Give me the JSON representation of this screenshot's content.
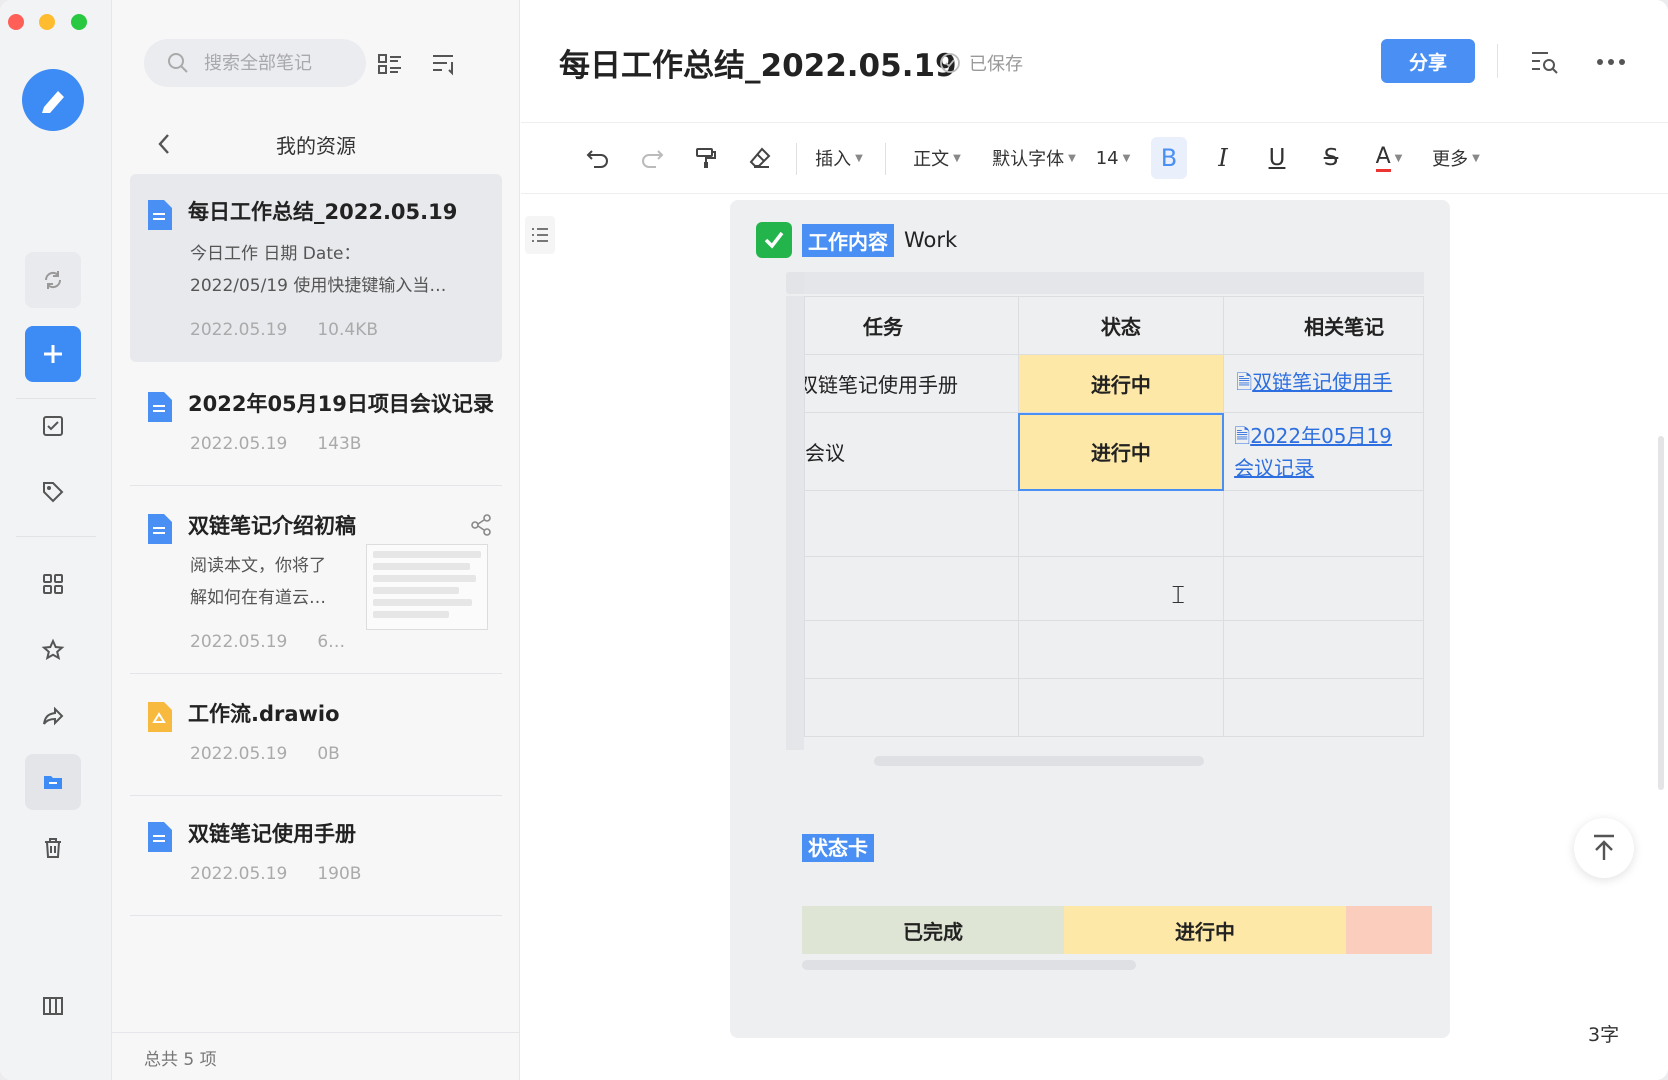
{
  "rail": {
    "items": [
      "sync",
      "add",
      "todo",
      "tags",
      "apps",
      "favorites",
      "shared",
      "my-resources",
      "trash",
      "layout"
    ]
  },
  "list": {
    "search_placeholder": "搜索全部笔记",
    "header": "我的资源",
    "footer": "总共 5 项",
    "items": [
      {
        "title": "每日工作总结_2022.05.19",
        "snippet1": "今日工作 日期 Date：",
        "snippet2": "2022/05/19 使用快捷键输入当…",
        "date": "2022.05.19",
        "size": "10.4KB"
      },
      {
        "title": "2022年05月19日项目会议记录",
        "date": "2022.05.19",
        "size": "143B"
      },
      {
        "title": "双链笔记介绍初稿",
        "snippet1": "阅读本文，你将了",
        "snippet2": "解如何在有道云…",
        "date": "2022.05.19",
        "size": "6…"
      },
      {
        "title": "工作流.drawio",
        "date": "2022.05.19",
        "size": "0B"
      },
      {
        "title": "双链笔记使用手册",
        "date": "2022.05.19",
        "size": "190B"
      }
    ]
  },
  "editor": {
    "title": "每日工作总结_2022.05.19",
    "saved": "已保存",
    "share": "分享",
    "toolbar": {
      "insert": "插入",
      "style": "正文",
      "font": "默认字体",
      "size": "14",
      "bold": "B",
      "italic": "I",
      "underline": "U",
      "strike": "S",
      "color": "A",
      "more": "更多"
    },
    "block": {
      "label": "工作内容",
      "label_en": "Work",
      "table": {
        "headers": [
          "任务",
          "状态",
          "相关笔记"
        ],
        "rows": [
          {
            "task": "双链笔记使用手册",
            "status": "进行中",
            "link": "双链笔记使用手"
          },
          {
            "task": "会议",
            "status": "进行中",
            "link1": "2022年05月19",
            "link2": "会议记录"
          }
        ]
      },
      "status_label": "状态卡",
      "status_bar": {
        "done": "已完成",
        "progress": "进行中"
      }
    },
    "word_count": "3字"
  },
  "colors": {
    "accent": "#4a8ff3",
    "status_yellow": "#fde8a7",
    "status_green": "#dfe5d4",
    "status_red": "#fbcdbd"
  }
}
